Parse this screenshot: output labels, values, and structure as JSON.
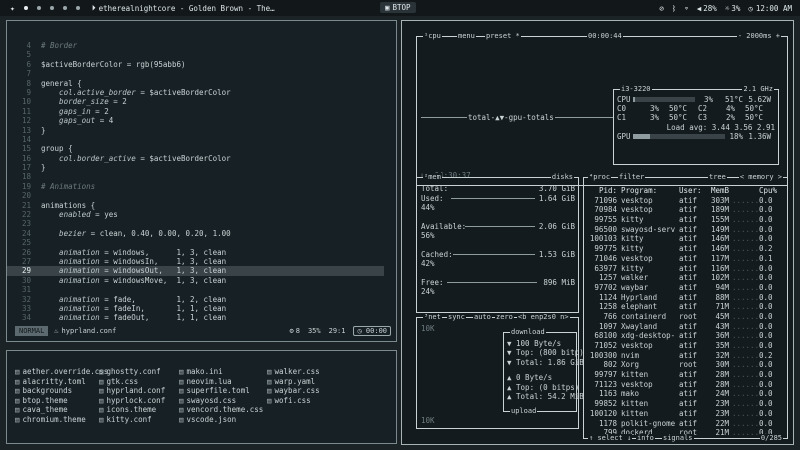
{
  "topbar": {
    "workspace_icon": "sparkle-icon",
    "window_title": "etherealnightcore - Golden Brown - The…",
    "app_label": "BTOP",
    "volume": "28%",
    "brightness": "3%",
    "time": "12:00 AM"
  },
  "editor": {
    "lines": [
      {
        "n": "4",
        "segs": [
          {
            "c": "cm",
            "t": "# Border"
          }
        ]
      },
      {
        "n": "5",
        "segs": []
      },
      {
        "n": "6",
        "segs": [
          {
            "c": "tx",
            "t": "$activeBorderColor = rgb(95abb6)"
          }
        ]
      },
      {
        "n": "7",
        "segs": []
      },
      {
        "n": "8",
        "segs": [
          {
            "c": "tx",
            "t": "general {"
          }
        ]
      },
      {
        "n": "9",
        "segs": [
          {
            "c": "kw",
            "t": "    col.active_border"
          },
          {
            "c": "tx",
            "t": " = $activeBorderColor"
          }
        ]
      },
      {
        "n": "10",
        "segs": [
          {
            "c": "kw",
            "t": "    border_size"
          },
          {
            "c": "tx",
            "t": " = 2"
          }
        ]
      },
      {
        "n": "11",
        "segs": [
          {
            "c": "kw",
            "t": "    gaps_in"
          },
          {
            "c": "tx",
            "t": " = 2"
          }
        ]
      },
      {
        "n": "12",
        "segs": [
          {
            "c": "kw",
            "t": "    gaps_out"
          },
          {
            "c": "tx",
            "t": " = 4"
          }
        ]
      },
      {
        "n": "13",
        "segs": [
          {
            "c": "tx",
            "t": "}"
          }
        ]
      },
      {
        "n": "14",
        "segs": []
      },
      {
        "n": "15",
        "segs": [
          {
            "c": "tx",
            "t": "group {"
          }
        ]
      },
      {
        "n": "16",
        "segs": [
          {
            "c": "kw",
            "t": "    col.border_active"
          },
          {
            "c": "tx",
            "t": " = $activeBorderColor"
          }
        ]
      },
      {
        "n": "17",
        "segs": [
          {
            "c": "tx",
            "t": "}"
          }
        ]
      },
      {
        "n": "18",
        "segs": []
      },
      {
        "n": "19",
        "segs": [
          {
            "c": "cm",
            "t": "# Animations"
          }
        ]
      },
      {
        "n": "20",
        "segs": []
      },
      {
        "n": "21",
        "segs": [
          {
            "c": "tx",
            "t": "animations {"
          }
        ]
      },
      {
        "n": "22",
        "segs": [
          {
            "c": "kw",
            "t": "    enabled"
          },
          {
            "c": "tx",
            "t": " = yes"
          }
        ]
      },
      {
        "n": "23",
        "segs": []
      },
      {
        "n": "24",
        "segs": [
          {
            "c": "kw",
            "t": "    bezier"
          },
          {
            "c": "tx",
            "t": " = clean, 0.40, 0.00, 0.20, 1.00"
          }
        ]
      },
      {
        "n": "25",
        "segs": []
      },
      {
        "n": "26",
        "segs": [
          {
            "c": "kw",
            "t": "    animation"
          },
          {
            "c": "tx",
            "t": " = windows,      1, 3, clean"
          }
        ]
      },
      {
        "n": "27",
        "segs": [
          {
            "c": "kw",
            "t": "    animation"
          },
          {
            "c": "tx",
            "t": " = windowsIn,    1, 3, clean"
          }
        ]
      },
      {
        "n": "29",
        "cur": true,
        "segs": [
          {
            "c": "kw",
            "t": "    animation"
          },
          {
            "c": "tx",
            "t": " = windowsOut,   1, 3, clean"
          }
        ]
      },
      {
        "n": "30",
        "segs": [
          {
            "c": "kw",
            "t": "    animation"
          },
          {
            "c": "tx",
            "t": " = windowsMove,  1, 3, clean"
          }
        ]
      },
      {
        "n": "31",
        "segs": []
      },
      {
        "n": "32",
        "segs": [
          {
            "c": "kw",
            "t": "    animation"
          },
          {
            "c": "tx",
            "t": " = fade,         1, 2, clean"
          }
        ]
      },
      {
        "n": "33",
        "segs": [
          {
            "c": "kw",
            "t": "    animation"
          },
          {
            "c": "tx",
            "t": " = fadeIn,       1, 1, clean"
          }
        ]
      },
      {
        "n": "34",
        "segs": [
          {
            "c": "kw",
            "t": "    animation"
          },
          {
            "c": "tx",
            "t": " = fadeOut,      1, 1, clean"
          }
        ]
      }
    ],
    "status": {
      "mode": "NORMAL",
      "file": "hyprland.conf",
      "lsp": "8",
      "percent": "35%",
      "position": "29:1",
      "time": "00:00"
    }
  },
  "files": [
    [
      "aether.override.css",
      "ghostty.conf",
      "mako.ini",
      "walker.css"
    ],
    [
      "alacritty.toml",
      "gtk.css",
      "neovim.lua",
      "warp.yaml"
    ],
    [
      "backgrounds",
      "hyprland.conf",
      "superfile.toml",
      "waybar.css"
    ],
    [
      "btop.theme",
      "hyprlock.conf",
      "swayosd.css",
      "wofi.css"
    ],
    [
      "cava_theme",
      "icons.theme",
      "vencord.theme.css",
      ""
    ],
    [
      "chromium.theme",
      "kitty.conf",
      "vscode.json",
      ""
    ]
  ],
  "btop": {
    "cpu": {
      "title": "cpu",
      "menu": "menu",
      "preset": "preset *",
      "clock": "00:00:44",
      "interval": "- 2000ms +",
      "graph_label": "total-▲▼-gpu-totals",
      "uptime": "up 04:30:37",
      "model": "i3-3220",
      "freq": "2.1 GHz",
      "total": {
        "label": "CPU",
        "pct": "3%",
        "temp": "51°C",
        "watt": "5.62W",
        "bar": 0.03
      },
      "cores": [
        {
          "a": "C0",
          "ap": "3%",
          "at": "50°C",
          "b": "C2",
          "bp": "4%",
          "bt": "50°C"
        },
        {
          "a": "C1",
          "ap": "3%",
          "at": "50°C",
          "b": "C3",
          "bp": "2%",
          "bt": "50°C"
        }
      ],
      "load_avg": "Load avg: 3.44  3.56  2.91",
      "gpu": {
        "label": "GPU",
        "pct": "18%",
        "watt": "1.36W",
        "bar": 0.18
      }
    },
    "mem": {
      "title": "mem",
      "disks": "disks",
      "total": {
        "label": "Total:",
        "val": "3.70 GiB"
      },
      "used": {
        "label": "Used:",
        "val": "1.64 GiB",
        "pct": "44%"
      },
      "available": {
        "label": "Available:",
        "val": "2.06 GiB",
        "pct": "56%"
      },
      "cached": {
        "label": "Cached:",
        "val": "1.53 GiB",
        "pct": "42%"
      },
      "free": {
        "label": "Free:",
        "val": "896 MiB",
        "pct": "24%"
      }
    },
    "net": {
      "title": "net",
      "sync": "sync",
      "auto": "auto",
      "zero": "zero",
      "iface": "<b enp2s0 n>",
      "scale_top": "10K",
      "scale_bottom": "10K",
      "download": "download",
      "dl_rate": "▼ 100 Byte/s",
      "dl_top": "▼ Top:  (800 bitp)",
      "dl_total": "▼ Total: 1.86 GiB",
      "ul_rate": "▲ 0 Byte/s",
      "ul_top": "▲ Top:   (0 bitps)",
      "ul_total": "▲ Total: 54.2 MiB",
      "upload": "upload"
    },
    "proc": {
      "title": "proc",
      "filter": "filter",
      "tree": "tree",
      "sort": "< memory >",
      "headers": {
        "pid": "Pid:",
        "prog": "Program:",
        "user": "User:",
        "mem": "MemB",
        "cpu": "Cpu%"
      },
      "rows": [
        [
          "71096",
          "vesktop",
          "atif",
          "303M",
          "0.0"
        ],
        [
          "70984",
          "vesktop",
          "atif",
          "189M",
          "0.0"
        ],
        [
          "99755",
          "kitty",
          "atif",
          "155M",
          "0.0"
        ],
        [
          "96500",
          "swayosd-serv",
          "atif",
          "149M",
          "0.0"
        ],
        [
          "100103",
          "kitty",
          "atif",
          "146M",
          "0.0"
        ],
        [
          "99775",
          "kitty",
          "atif",
          "146M",
          "0.2"
        ],
        [
          "71046",
          "vesktop",
          "atif",
          "117M",
          "0.1"
        ],
        [
          "63977",
          "kitty",
          "atif",
          "116M",
          "0.0"
        ],
        [
          "1257",
          "walker",
          "atif",
          "102M",
          "0.0"
        ],
        [
          "97702",
          "waybar",
          "atif",
          "94M",
          "0.0"
        ],
        [
          "1124",
          "Hyprland",
          "atif",
          "88M",
          "0.0"
        ],
        [
          "1258",
          "elephant",
          "atif",
          "71M",
          "0.0"
        ],
        [
          "766",
          "containerd",
          "root",
          "45M",
          "0.0"
        ],
        [
          "1097",
          "Xwayland",
          "atif",
          "43M",
          "0.0"
        ],
        [
          "68100",
          "xdg-desktop-",
          "atif",
          "36M",
          "0.0"
        ],
        [
          "71052",
          "vesktop",
          "atif",
          "35M",
          "0.0"
        ],
        [
          "100300",
          "nvim",
          "atif",
          "32M",
          "0.2"
        ],
        [
          "802",
          "Xorg",
          "root",
          "30M",
          "0.0"
        ],
        [
          "99797",
          "kitten",
          "atif",
          "28M",
          "0.0"
        ],
        [
          "71123",
          "vesktop",
          "atif",
          "28M",
          "0.0"
        ],
        [
          "1163",
          "mako",
          "atif",
          "24M",
          "0.0"
        ],
        [
          "99852",
          "kitten",
          "atif",
          "23M",
          "0.0"
        ],
        [
          "100120",
          "kitten",
          "atif",
          "23M",
          "0.0"
        ],
        [
          "1178",
          "polkit-gnome",
          "atif",
          "22M",
          "0.0"
        ],
        [
          "799",
          "dockerd",
          "root",
          "21M",
          "0.0"
        ]
      ],
      "footer_select": "select",
      "footer_info": "info",
      "footer_signals": "signals",
      "count": "0/285"
    }
  },
  "colors": {
    "accent": "#95abb6",
    "bg": "#1c2326",
    "panel": "#141b1e"
  }
}
